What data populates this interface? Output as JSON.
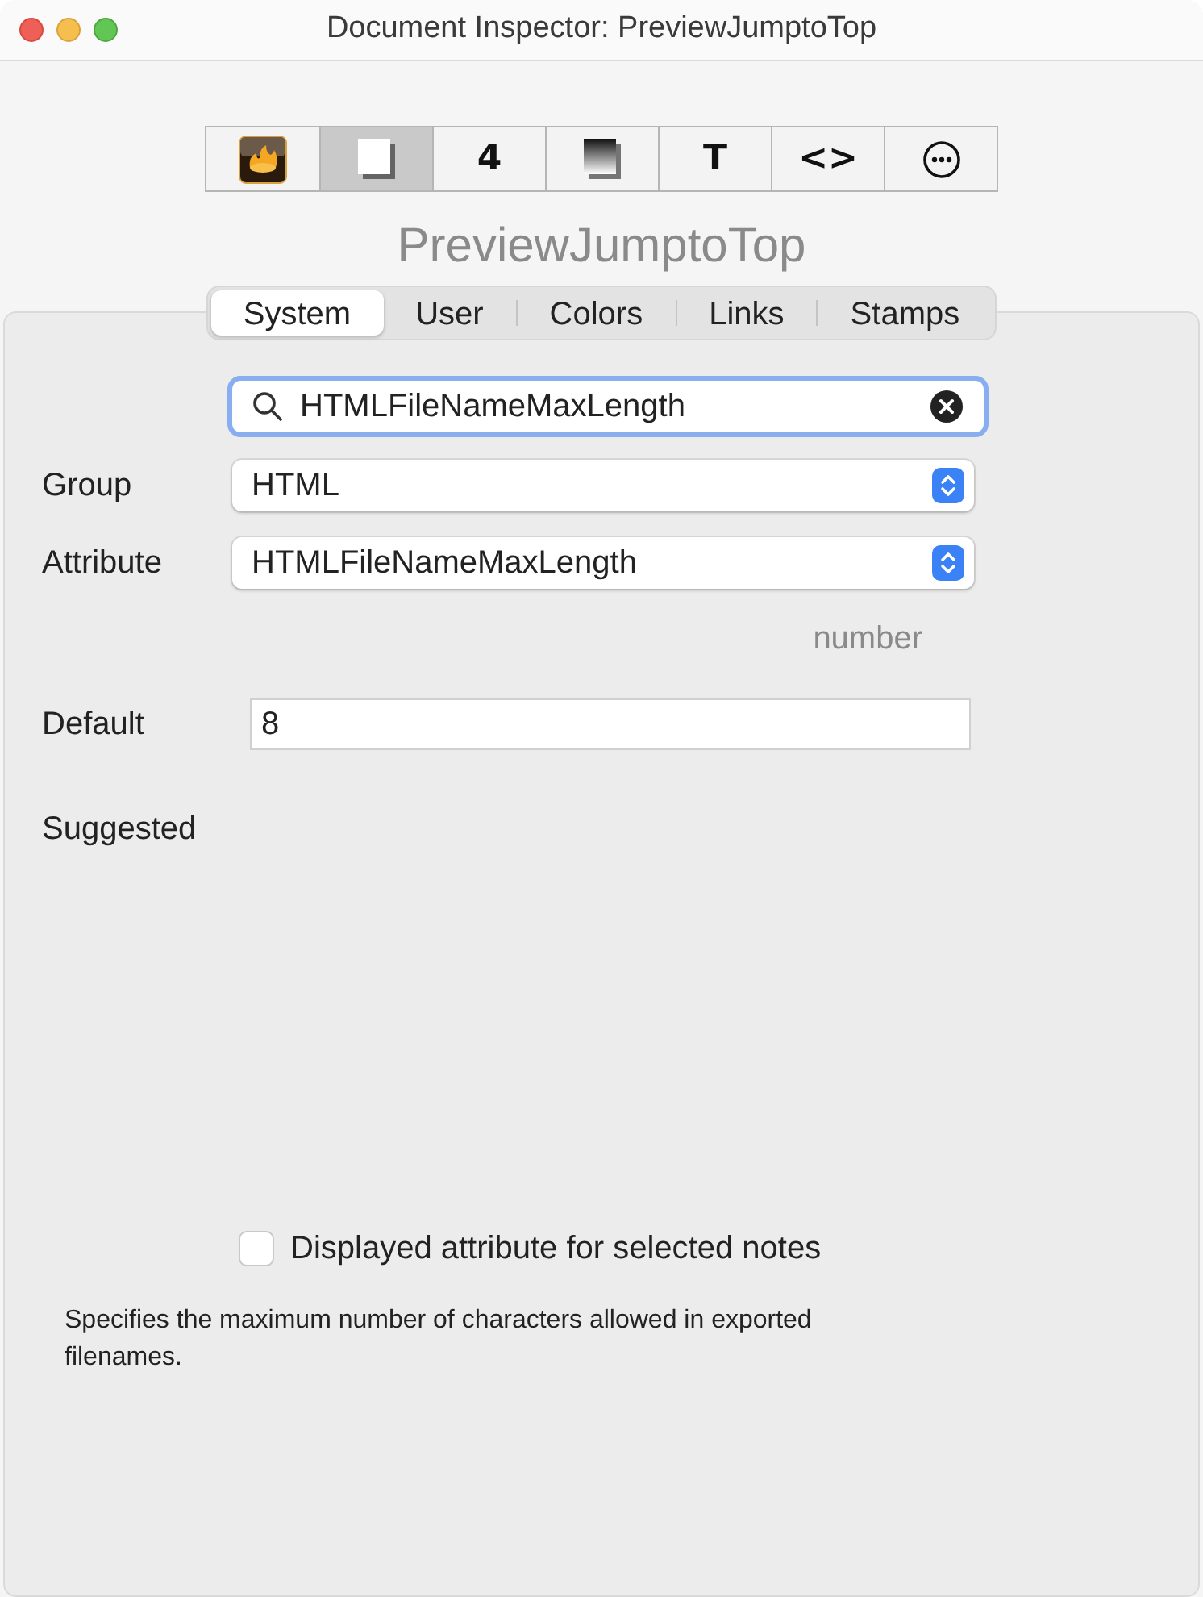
{
  "window": {
    "title": "Document Inspector: PreviewJumptoTop"
  },
  "toolbar": [
    {
      "kind": "app",
      "selected": false
    },
    {
      "kind": "page",
      "selected": true
    },
    {
      "kind": "glyph",
      "glyph": "4",
      "selected": false
    },
    {
      "kind": "gradient",
      "selected": false
    },
    {
      "kind": "glyph",
      "glyph": "T",
      "selected": false
    },
    {
      "kind": "glyph",
      "glyph": "<>",
      "selected": false
    },
    {
      "kind": "more",
      "selected": false
    }
  ],
  "document_name": "PreviewJumptoTop",
  "tabs": [
    {
      "label": "System",
      "selected": true
    },
    {
      "label": "User",
      "selected": false
    },
    {
      "label": "Colors",
      "selected": false
    },
    {
      "label": "Links",
      "selected": false
    },
    {
      "label": "Stamps",
      "selected": false
    }
  ],
  "search": {
    "value": "HTMLFileNameMaxLength"
  },
  "group": {
    "label": "Group",
    "value": "HTML"
  },
  "attribute": {
    "label": "Attribute",
    "value": "HTMLFileNameMaxLength"
  },
  "type": "number",
  "default": {
    "label": "Default",
    "value": "8"
  },
  "suggested": {
    "label": "Suggested"
  },
  "displayed_checkbox": {
    "label": "Displayed attribute for selected notes",
    "checked": false
  },
  "description": "Specifies the maximum number of characters allowed in exported filenames."
}
